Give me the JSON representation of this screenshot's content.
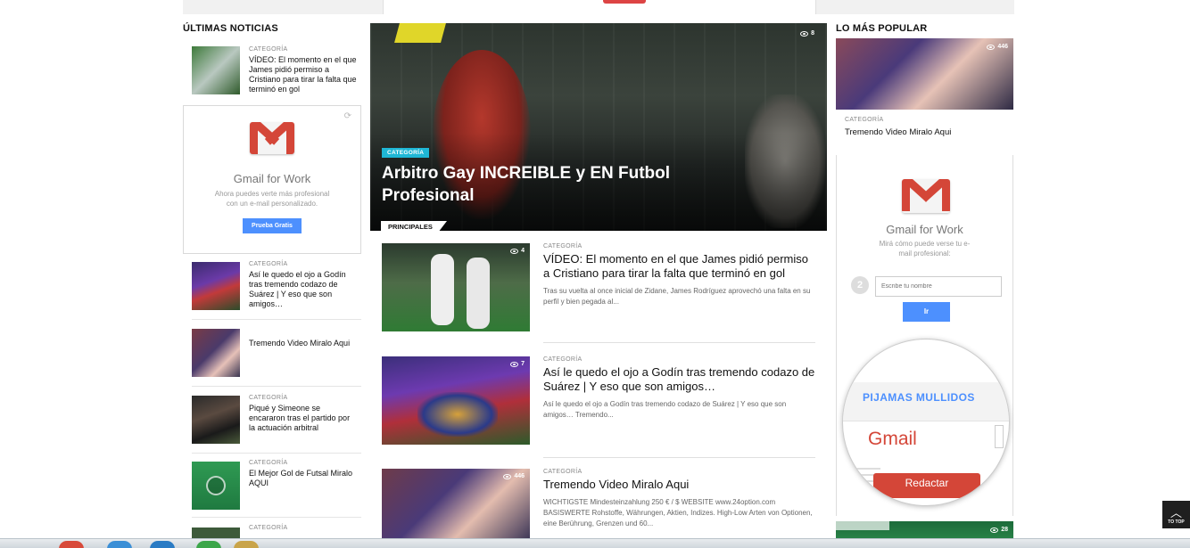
{
  "sections": {
    "latest": "ÚLTIMAS NOTICIAS",
    "popular": "LO MÁS POPULAR"
  },
  "left_items": [
    {
      "category": "CATEGORÍA",
      "title": "VÍDEO: El momento en el que James pidió permiso a Cristiano para tirar la falta que terminó en gol"
    },
    {
      "category": "CATEGORÍA",
      "title": "Así le quedo el ojo a Godín tras tremendo codazo de Suárez | Y eso que son amigos…"
    },
    {
      "category": "CATEGORÍA",
      "title": "Tremendo Video Miralo Aqui"
    },
    {
      "category": "CATEGORÍA",
      "title": "Piqué y Simeone se encararon tras el partido por la actuación arbitral"
    },
    {
      "category": "CATEGORÍA",
      "title": "El Mejor Gol de Futsal Miralo AQUI"
    },
    {
      "category": "CATEGORÍA",
      "title": ""
    }
  ],
  "left_ad": {
    "title": "Gmail for Work",
    "subtitle": "Ahora puedes verte más profesional con un e-mail personalizado.",
    "button": "Prueba Gratis"
  },
  "hero": {
    "views": "8",
    "category": "CATEGORÍA",
    "title": "Arbitro Gay INCREIBLE y EN Futbol Profesional",
    "section_label": "PRINCIPALES"
  },
  "articles": [
    {
      "category": "CATEGORÍA",
      "views": "4",
      "title": "VÍDEO: El momento en el que James pidió permiso a Cristiano para tirar la falta que terminó en gol",
      "excerpt": "Tras su vuelta al once inicial de Zidane, James Rodríguez aprovechó una falta en su perfil y bien pegada al..."
    },
    {
      "category": "CATEGORÍA",
      "views": "7",
      "title": "Así le quedo el ojo a Godín tras tremendo codazo de Suárez | Y eso que son amigos…",
      "excerpt": "Así le quedo el ojo a Godín tras tremendo codazo de Suárez | Y eso que son amigos… Tremendo..."
    },
    {
      "category": "CATEGORÍA",
      "views": "446",
      "title": "Tremendo Video Miralo Aqui",
      "excerpt": "WICHTIGSTE Mindesteinzahlung 250 € / $ WEBSITE www.24option.com BASISWERTE Rohstoffe, Währungen, Aktien, Indizes. High-Low Arten von Optionen, eine Berührung, Grenzen und 60..."
    }
  ],
  "popular": {
    "views": "446",
    "category": "CATEGORÍA",
    "title": "Tremendo Video Miralo Aqui",
    "bottom_views": "28"
  },
  "right_ad": {
    "title": "Gmail for Work",
    "subtitle": "Mirá cómo puede verse tu e-mail profesional:",
    "step": "2",
    "input_placeholder": "Escribe tu nombre",
    "button": "Ir",
    "magnify_label": "PIJAMAS MULLIDOS",
    "magnify_brand": "Gmail",
    "compose": "Redactar"
  },
  "to_top": {
    "label": "TO TOP"
  },
  "colors": {
    "accent": "#1fb7d6",
    "gmail_red": "#d44638",
    "google_blue": "#4d90fe"
  }
}
